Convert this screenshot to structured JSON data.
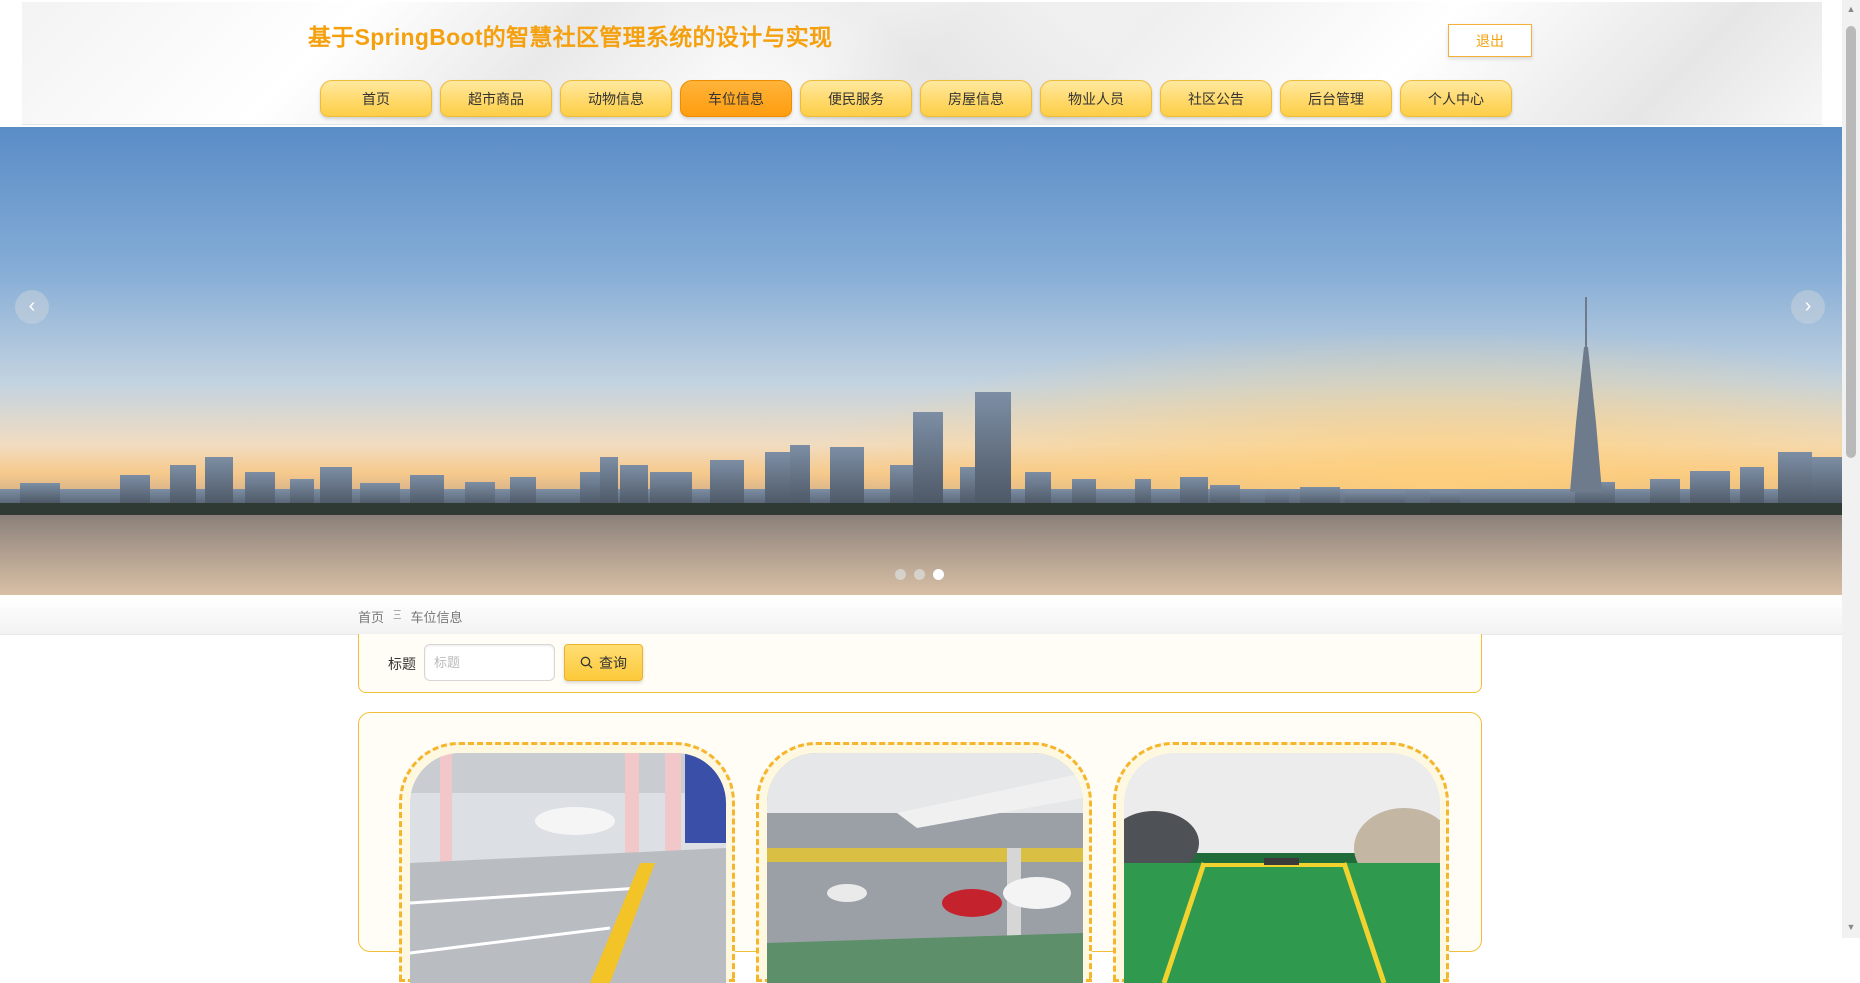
{
  "header": {
    "title": "基于SpringBoot的智慧社区管理系统的设计与实现",
    "logout_label": "退出"
  },
  "nav": {
    "items": [
      {
        "label": "首页"
      },
      {
        "label": "超市商品"
      },
      {
        "label": "动物信息"
      },
      {
        "label": "车位信息",
        "active": true
      },
      {
        "label": "便民服务"
      },
      {
        "label": "房屋信息"
      },
      {
        "label": "物业人员"
      },
      {
        "label": "社区公告"
      },
      {
        "label": "后台管理"
      },
      {
        "label": "个人中心"
      }
    ]
  },
  "banner": {
    "prev_icon": "‹",
    "next_icon": "›",
    "slide_count": 3,
    "active_slide": 3
  },
  "breadcrumb": {
    "home": "首页",
    "separator": "Ξ",
    "current": "车位信息"
  },
  "search": {
    "label": "标题",
    "placeholder": "标题",
    "button_label": "查询"
  },
  "colors": {
    "accent": "#f5a10f",
    "nav_bg": "#ffd96b",
    "nav_active": "#ff9d0f",
    "border": "#f2c038"
  }
}
